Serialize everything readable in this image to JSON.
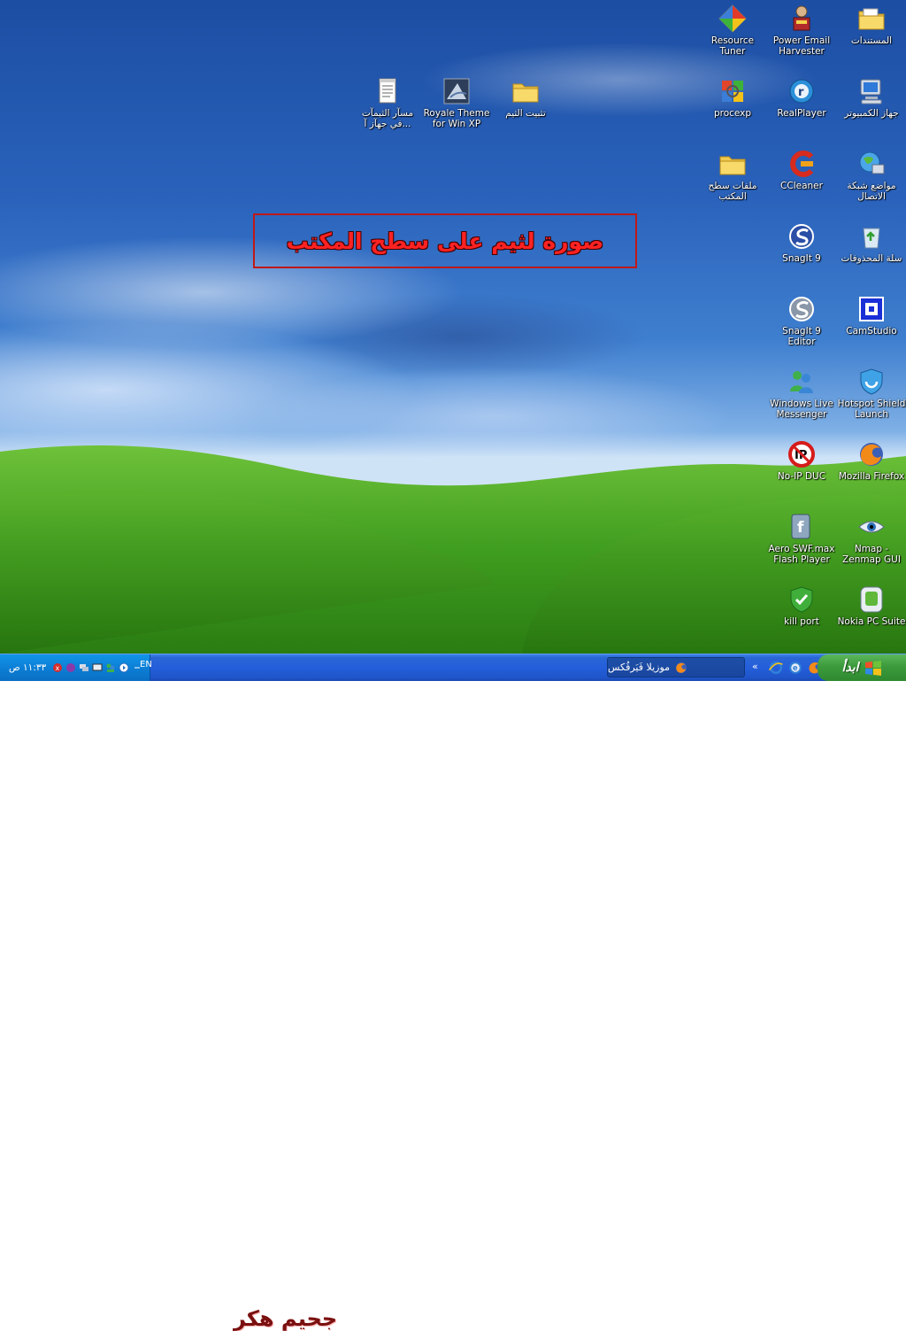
{
  "desktop": {
    "icons": [
      {
        "label": "Resource Tuner"
      },
      {
        "label": "Power Email Harvester"
      },
      {
        "label": "المستندات"
      },
      {
        "label": "procexp"
      },
      {
        "label": "RealPlayer"
      },
      {
        "label": "جهاز الكمبيوتر"
      },
      {
        "label": "ملفات سطح المكتب"
      },
      {
        "label": "CCleaner"
      },
      {
        "label": "مواضع شبكة الاتصال"
      },
      {
        "label": "SnagIt 9"
      },
      {
        "label": "سلة المحذوفات"
      },
      {
        "label": "SnagIt 9 Editor"
      },
      {
        "label": "CamStudio"
      },
      {
        "label": "Windows Live Messenger"
      },
      {
        "label": "Hotspot Shield Launch"
      },
      {
        "label": "No-IP DUC"
      },
      {
        "label": "Mozilla Firefox"
      },
      {
        "label": "Aero SWF.max Flash Player"
      },
      {
        "label": "Nmap - Zenmap GUI"
      },
      {
        "label": "kill port"
      },
      {
        "label": "Nokia PC Suite"
      },
      {
        "label": "مسآر الثيمآت ...في جهآز آ"
      },
      {
        "label": "Royale Theme for Win XP"
      },
      {
        "label": "تثبيت الثيم"
      }
    ],
    "callout_text": "صورة لثيم على سطح المكتب"
  },
  "taskbar": {
    "start_label": "ابدأ",
    "task_label": "موزيلا فَيَرفُكس",
    "language": "EN",
    "clock": "١١:٣٣ ص",
    "watermark": "جحيم هكر"
  },
  "colors": {
    "taskbar": "#245edb",
    "start": "#3c9a3c",
    "tray": "#0c7fd6",
    "callout_border": "#c01818",
    "callout_text": "#ff2222"
  }
}
